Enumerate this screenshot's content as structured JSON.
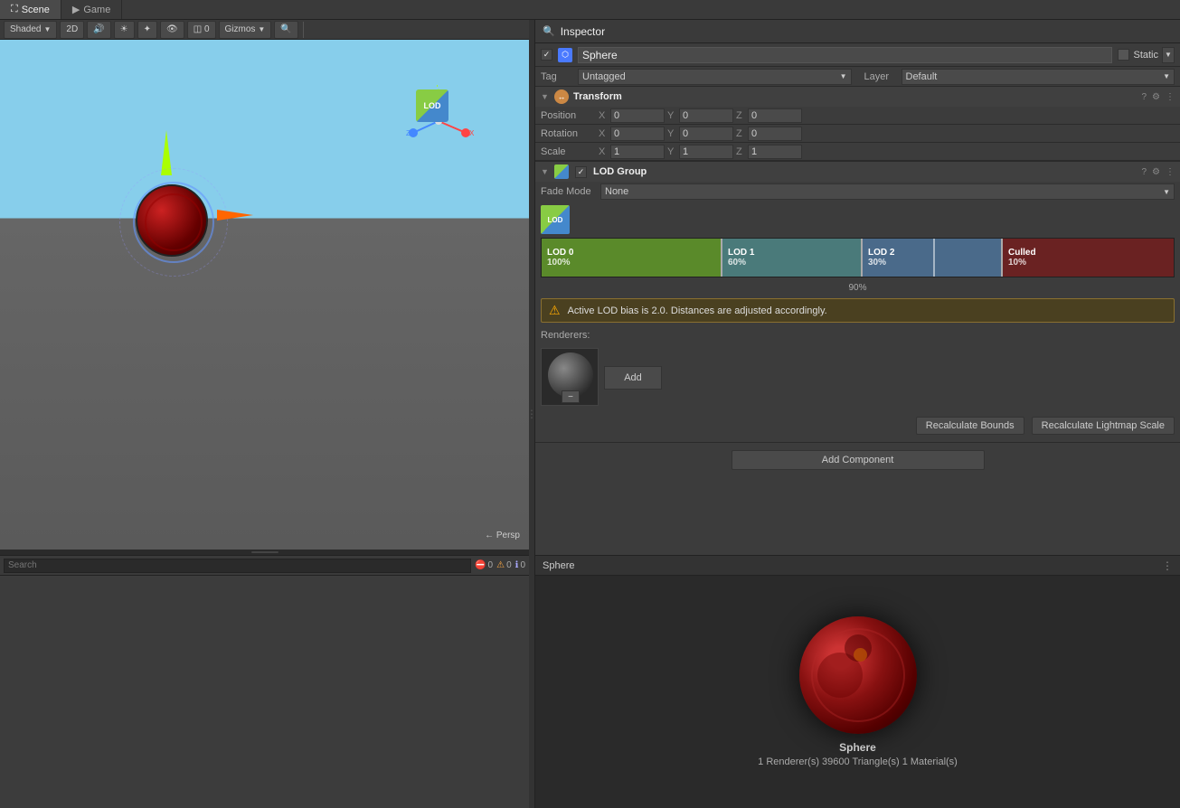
{
  "header": {
    "scene_tab": "Scene",
    "game_tab": "Game"
  },
  "scene_toolbar": {
    "shaded_label": "Shaded",
    "2d_label": "2D",
    "gizmos_label": "Gizmos"
  },
  "scene": {
    "persp_label": "← Persp"
  },
  "inspector": {
    "title": "Inspector",
    "go": {
      "name": "Sphere",
      "static_label": "Static",
      "tag_label": "Tag",
      "tag_value": "Untagged",
      "layer_label": "Layer",
      "layer_value": "Default"
    },
    "transform": {
      "title": "Transform",
      "position_label": "Position",
      "rotation_label": "Rotation",
      "scale_label": "Scale",
      "pos_x": "0",
      "pos_y": "0",
      "pos_z": "0",
      "rot_x": "0",
      "rot_y": "0",
      "rot_z": "0",
      "scale_x": "1",
      "scale_y": "1",
      "scale_z": "1"
    },
    "lod_group": {
      "title": "LOD Group",
      "fade_mode_label": "Fade Mode",
      "fade_mode_value": "None",
      "lod0_label": "LOD 0",
      "lod0_pct": "100%",
      "lod1_label": "LOD 1",
      "lod1_pct": "60%",
      "lod2_label": "LOD 2",
      "lod2_pct": "30%",
      "culled_label": "Culled",
      "culled_pct": "10%",
      "indicator_pct": "90%",
      "warning_text": "Active LOD bias is 2.0. Distances are adjusted accordingly.",
      "renderers_label": "Renderers:",
      "add_btn": "Add",
      "recalc_bounds_btn": "Recalculate Bounds",
      "recalc_lightmap_btn": "Recalculate Lightmap Scale"
    },
    "add_component_btn": "Add Component"
  },
  "preview": {
    "title": "Sphere",
    "name": "Sphere",
    "info_line1": "1 Renderer(s)   39600 Triangle(s)   1 Material(s)"
  },
  "console": {
    "search_placeholder": "Search",
    "error_count": "0",
    "warning_count": "0",
    "info_count": "0"
  }
}
